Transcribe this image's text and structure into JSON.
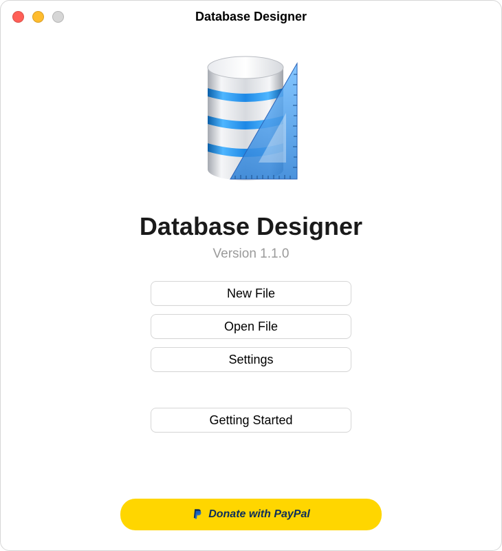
{
  "window": {
    "title": "Database Designer"
  },
  "app": {
    "name": "Database Designer",
    "version_label": "Version 1.1.0"
  },
  "buttons": {
    "new_file": "New File",
    "open_file": "Open File",
    "settings": "Settings",
    "getting_started": "Getting Started"
  },
  "donate": {
    "label": "Donate with PayPal"
  }
}
